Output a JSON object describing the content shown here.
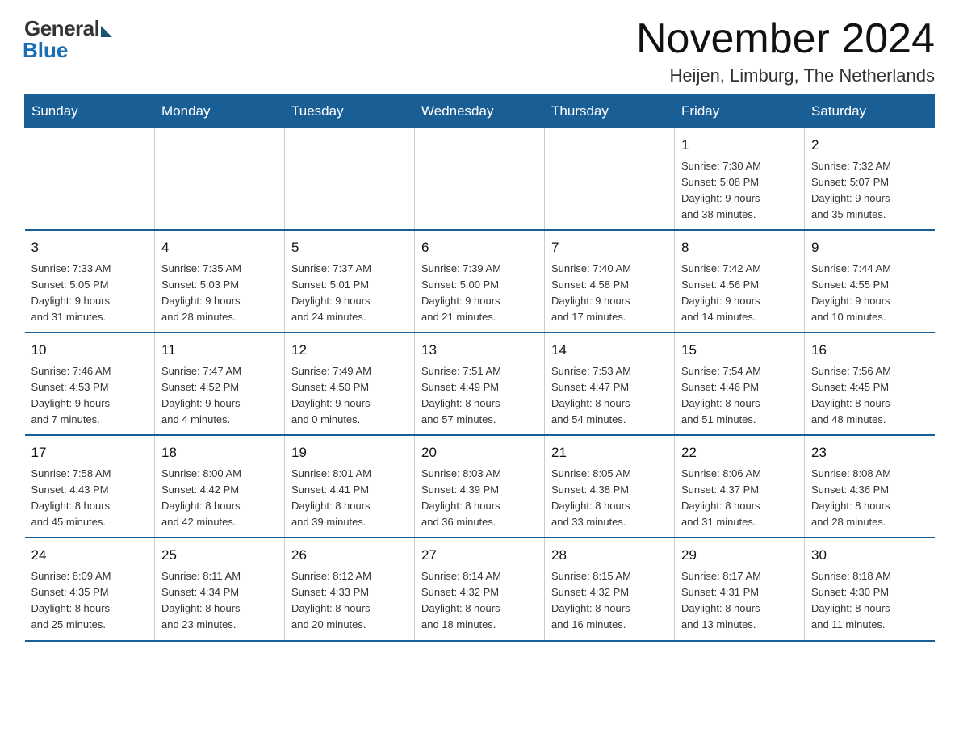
{
  "logo": {
    "general": "General",
    "blue": "Blue"
  },
  "title": "November 2024",
  "subtitle": "Heijen, Limburg, The Netherlands",
  "weekdays": [
    "Sunday",
    "Monday",
    "Tuesday",
    "Wednesday",
    "Thursday",
    "Friday",
    "Saturday"
  ],
  "weeks": [
    [
      {
        "day": "",
        "info": ""
      },
      {
        "day": "",
        "info": ""
      },
      {
        "day": "",
        "info": ""
      },
      {
        "day": "",
        "info": ""
      },
      {
        "day": "",
        "info": ""
      },
      {
        "day": "1",
        "info": "Sunrise: 7:30 AM\nSunset: 5:08 PM\nDaylight: 9 hours\nand 38 minutes."
      },
      {
        "day": "2",
        "info": "Sunrise: 7:32 AM\nSunset: 5:07 PM\nDaylight: 9 hours\nand 35 minutes."
      }
    ],
    [
      {
        "day": "3",
        "info": "Sunrise: 7:33 AM\nSunset: 5:05 PM\nDaylight: 9 hours\nand 31 minutes."
      },
      {
        "day": "4",
        "info": "Sunrise: 7:35 AM\nSunset: 5:03 PM\nDaylight: 9 hours\nand 28 minutes."
      },
      {
        "day": "5",
        "info": "Sunrise: 7:37 AM\nSunset: 5:01 PM\nDaylight: 9 hours\nand 24 minutes."
      },
      {
        "day": "6",
        "info": "Sunrise: 7:39 AM\nSunset: 5:00 PM\nDaylight: 9 hours\nand 21 minutes."
      },
      {
        "day": "7",
        "info": "Sunrise: 7:40 AM\nSunset: 4:58 PM\nDaylight: 9 hours\nand 17 minutes."
      },
      {
        "day": "8",
        "info": "Sunrise: 7:42 AM\nSunset: 4:56 PM\nDaylight: 9 hours\nand 14 minutes."
      },
      {
        "day": "9",
        "info": "Sunrise: 7:44 AM\nSunset: 4:55 PM\nDaylight: 9 hours\nand 10 minutes."
      }
    ],
    [
      {
        "day": "10",
        "info": "Sunrise: 7:46 AM\nSunset: 4:53 PM\nDaylight: 9 hours\nand 7 minutes."
      },
      {
        "day": "11",
        "info": "Sunrise: 7:47 AM\nSunset: 4:52 PM\nDaylight: 9 hours\nand 4 minutes."
      },
      {
        "day": "12",
        "info": "Sunrise: 7:49 AM\nSunset: 4:50 PM\nDaylight: 9 hours\nand 0 minutes."
      },
      {
        "day": "13",
        "info": "Sunrise: 7:51 AM\nSunset: 4:49 PM\nDaylight: 8 hours\nand 57 minutes."
      },
      {
        "day": "14",
        "info": "Sunrise: 7:53 AM\nSunset: 4:47 PM\nDaylight: 8 hours\nand 54 minutes."
      },
      {
        "day": "15",
        "info": "Sunrise: 7:54 AM\nSunset: 4:46 PM\nDaylight: 8 hours\nand 51 minutes."
      },
      {
        "day": "16",
        "info": "Sunrise: 7:56 AM\nSunset: 4:45 PM\nDaylight: 8 hours\nand 48 minutes."
      }
    ],
    [
      {
        "day": "17",
        "info": "Sunrise: 7:58 AM\nSunset: 4:43 PM\nDaylight: 8 hours\nand 45 minutes."
      },
      {
        "day": "18",
        "info": "Sunrise: 8:00 AM\nSunset: 4:42 PM\nDaylight: 8 hours\nand 42 minutes."
      },
      {
        "day": "19",
        "info": "Sunrise: 8:01 AM\nSunset: 4:41 PM\nDaylight: 8 hours\nand 39 minutes."
      },
      {
        "day": "20",
        "info": "Sunrise: 8:03 AM\nSunset: 4:39 PM\nDaylight: 8 hours\nand 36 minutes."
      },
      {
        "day": "21",
        "info": "Sunrise: 8:05 AM\nSunset: 4:38 PM\nDaylight: 8 hours\nand 33 minutes."
      },
      {
        "day": "22",
        "info": "Sunrise: 8:06 AM\nSunset: 4:37 PM\nDaylight: 8 hours\nand 31 minutes."
      },
      {
        "day": "23",
        "info": "Sunrise: 8:08 AM\nSunset: 4:36 PM\nDaylight: 8 hours\nand 28 minutes."
      }
    ],
    [
      {
        "day": "24",
        "info": "Sunrise: 8:09 AM\nSunset: 4:35 PM\nDaylight: 8 hours\nand 25 minutes."
      },
      {
        "day": "25",
        "info": "Sunrise: 8:11 AM\nSunset: 4:34 PM\nDaylight: 8 hours\nand 23 minutes."
      },
      {
        "day": "26",
        "info": "Sunrise: 8:12 AM\nSunset: 4:33 PM\nDaylight: 8 hours\nand 20 minutes."
      },
      {
        "day": "27",
        "info": "Sunrise: 8:14 AM\nSunset: 4:32 PM\nDaylight: 8 hours\nand 18 minutes."
      },
      {
        "day": "28",
        "info": "Sunrise: 8:15 AM\nSunset: 4:32 PM\nDaylight: 8 hours\nand 16 minutes."
      },
      {
        "day": "29",
        "info": "Sunrise: 8:17 AM\nSunset: 4:31 PM\nDaylight: 8 hours\nand 13 minutes."
      },
      {
        "day": "30",
        "info": "Sunrise: 8:18 AM\nSunset: 4:30 PM\nDaylight: 8 hours\nand 11 minutes."
      }
    ]
  ]
}
